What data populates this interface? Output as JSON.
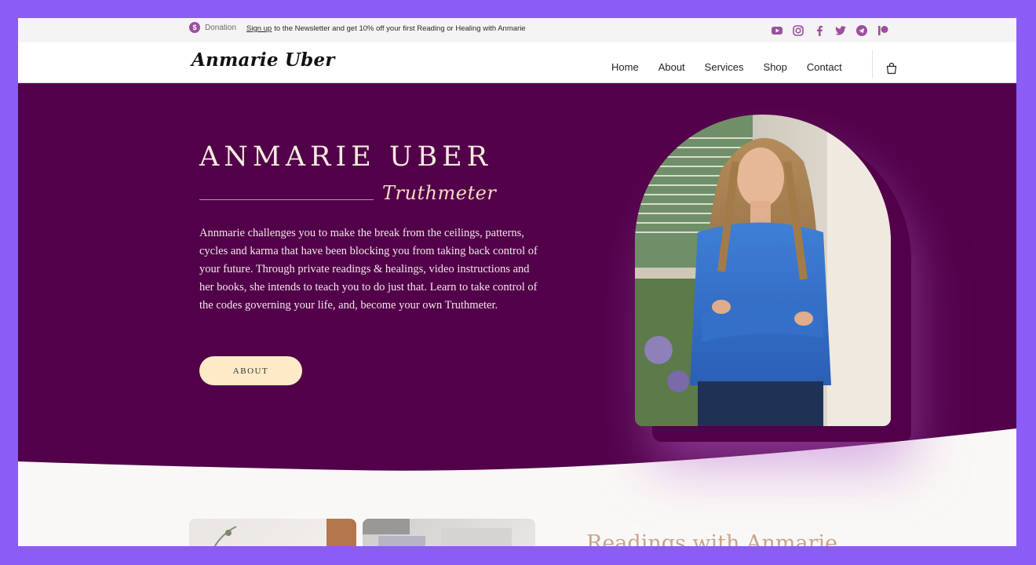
{
  "topbar": {
    "donation_label": "Donation",
    "donation_icon": "dollar-coin-icon",
    "signup_link": "Sign up",
    "promo_text": "to the Newsletter and get 10% off your first Reading or Healing with Anmarie",
    "socials": [
      "youtube-icon",
      "instagram-icon",
      "facebook-icon",
      "twitter-icon",
      "telegram-icon",
      "patreon-icon"
    ],
    "icon_color": "#9b4f9f"
  },
  "header": {
    "logo": "Anmarie Uber",
    "nav": [
      "Home",
      "About",
      "Services",
      "Shop",
      "Contact"
    ],
    "cart_icon": "shopping-bag-icon"
  },
  "hero": {
    "title": "ANMARIE UBER",
    "subtitle_script": "Truthmeter",
    "body": "Annmarie challenges you to make the break from the ceilings, patterns, cycles and karma that have been blocking you from taking back control of your future. Through private readings & healings, video instructions and her books, she intends to teach you to do just that. Learn to take control of the codes governing your life, and, become your own Truthmeter.",
    "button_label": "ABOUT",
    "bg_color": "#520049",
    "button_color": "#fdebc8"
  },
  "section": {
    "heading": "Readings with Anmarie"
  }
}
